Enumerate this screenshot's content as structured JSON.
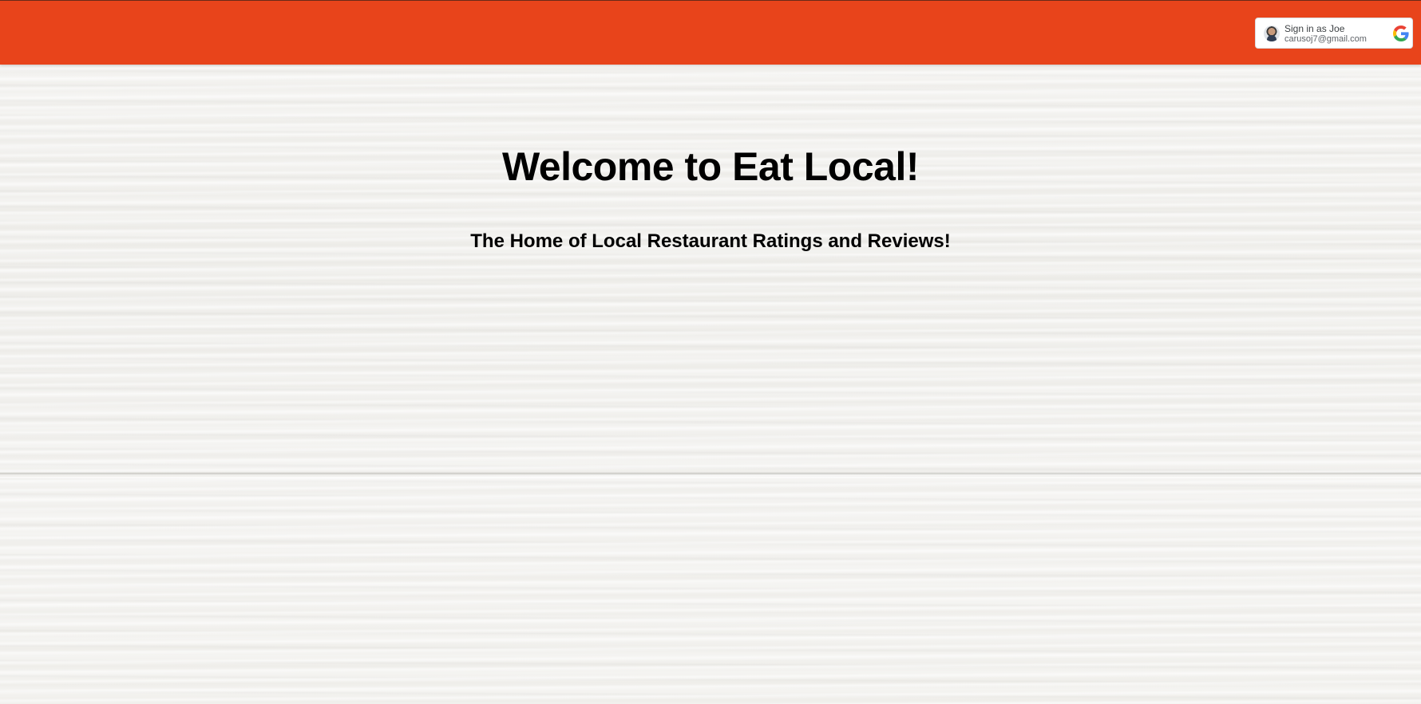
{
  "header": {
    "color": "#e8441b",
    "google_signin": {
      "name_label": "Sign in as Joe",
      "email": "carusoj7@gmail.com",
      "avatar_icon": "user-avatar",
      "logo_icon": "google-g-icon"
    }
  },
  "main": {
    "title": "Welcome to Eat Local!",
    "subtitle": "The Home of Local Restaurant Ratings and Reviews!"
  }
}
